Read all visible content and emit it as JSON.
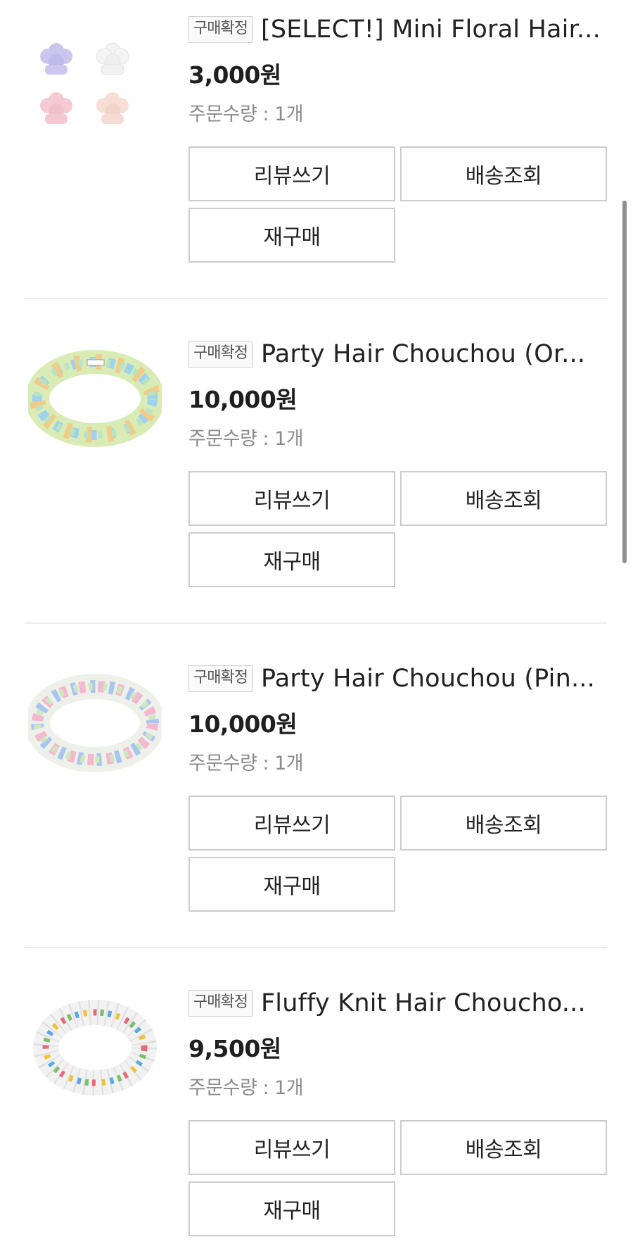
{
  "orders": [
    {
      "image_icon": "mini-floral-hair-claw-image",
      "badge": "구매확정",
      "title": "[SELECT!] Mini Floral Hair...",
      "price": "3,000원",
      "quantity": "주문수량 : 1개",
      "buttons": {
        "review": "리뷰쓰기",
        "tracking": "배송조회",
        "rebuy": "재구매"
      }
    },
    {
      "image_icon": "party-hair-chouchou-orange-image",
      "badge": "구매확정",
      "title": "Party Hair Chouchou (Or...",
      "price": "10,000원",
      "quantity": "주문수량 : 1개",
      "buttons": {
        "review": "리뷰쓰기",
        "tracking": "배송조회",
        "rebuy": "재구매"
      }
    },
    {
      "image_icon": "party-hair-chouchou-pink-image",
      "badge": "구매확정",
      "title": "Party Hair Chouchou (Pin...",
      "price": "10,000원",
      "quantity": "주문수량 : 1개",
      "buttons": {
        "review": "리뷰쓰기",
        "tracking": "배송조회",
        "rebuy": "재구매"
      }
    },
    {
      "image_icon": "fluffy-knit-hair-chouchou-image",
      "badge": "구매확정",
      "title": "Fluffy Knit Hair Choucho...",
      "price": "9,500원",
      "quantity": "주문수량 : 1개",
      "buttons": {
        "review": "리뷰쓰기",
        "tracking": "배송조회",
        "rebuy": "재구매"
      }
    }
  ],
  "colors": {
    "border": "#cccccc",
    "divider": "#ececec",
    "muted_text": "#8a8a8a",
    "scrollbar": "#8f8f8f"
  }
}
